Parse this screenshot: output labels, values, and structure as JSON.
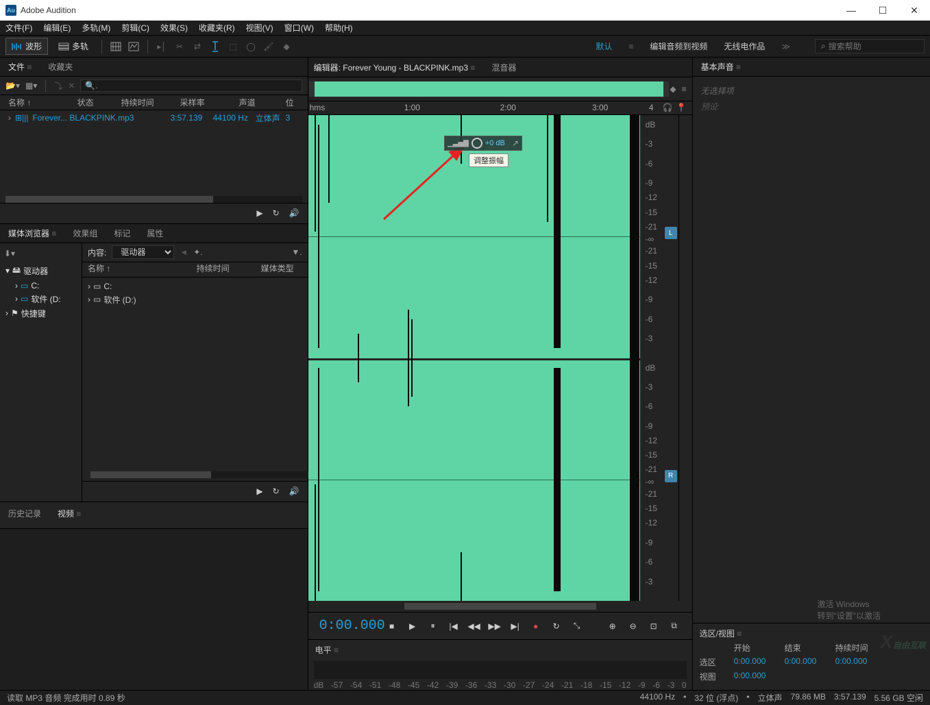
{
  "app": {
    "title": "Adobe Audition",
    "logo_text": "Au"
  },
  "menu": [
    "文件(F)",
    "编辑(E)",
    "多轨(M)",
    "剪辑(C)",
    "效果(S)",
    "收藏夹(R)",
    "视图(V)",
    "窗口(W)",
    "帮助(H)"
  ],
  "views": {
    "waveform": "波形",
    "multitrack": "多轨"
  },
  "workspaces": {
    "default": "默认",
    "edit_audio_to_video": "编辑音频到视频",
    "radio": "无线电作品"
  },
  "search_placeholder": "搜索帮助",
  "files_panel": {
    "tab_files": "文件",
    "tab_fav": "收藏夹",
    "headers": {
      "name": "名称 ↑",
      "status": "状态",
      "duration": "持续时间",
      "sample_rate": "采样率",
      "channels": "声道",
      "bit": "位"
    },
    "row": {
      "name": "Forever... BLACKPINK.mp3",
      "duration": "3:57.139",
      "sample_rate": "44100 Hz",
      "channels": "立体声",
      "bit": "3"
    }
  },
  "media_panel": {
    "tabs": [
      "媒体浏览器",
      "效果组",
      "标记",
      "属性"
    ],
    "content_label": "内容:",
    "content_value": "驱动器",
    "cols": {
      "name": "名称 ↑",
      "duration": "持续时间",
      "type": "媒体类型"
    },
    "tree": [
      "驱动器",
      "C:",
      "软件 (D:",
      "快捷键"
    ],
    "list": [
      "C:",
      "软件 (D:)"
    ]
  },
  "history": {
    "tab_history": "历史记录",
    "tab_video": "视频"
  },
  "editor": {
    "tab": "编辑器: Forever Young - BLACKPINK.mp3",
    "mixer": "混音器",
    "timeline": [
      "hms",
      "1:00",
      "2:00",
      "3:00",
      "4"
    ],
    "db_labels": [
      "dB",
      "-3",
      "-6",
      "-9",
      "-12",
      "-15",
      "-21",
      "-∞",
      "-21",
      "-15",
      "-12",
      "-9",
      "-6",
      "-3"
    ],
    "channel_L": "L",
    "channel_R": "R",
    "hud_value": "+0 dB",
    "tooltip": "调整振幅",
    "time": "0:00.000"
  },
  "levels": {
    "title": "电平",
    "marks": [
      "dB",
      "-57",
      "-54",
      "-51",
      "-48",
      "-45",
      "-42",
      "-39",
      "-36",
      "-33",
      "-30",
      "-27",
      "-24",
      "-21",
      "-18",
      "-15",
      "-12",
      "-9",
      "-6",
      "-3",
      "0"
    ]
  },
  "right_panel": {
    "title": "基本声音",
    "no_selection": "无选择项",
    "preset": "预设:"
  },
  "sel_view": {
    "title": "选区/视图",
    "cols": [
      "开始",
      "结束",
      "持续时间"
    ],
    "rows": {
      "sel": "选区",
      "view": "视图"
    },
    "values": {
      "sel_start": "0:00.000",
      "sel_end": "0:00.000",
      "sel_dur": "0:00.000",
      "view_start": "0:00.000"
    }
  },
  "status": {
    "left": "读取 MP3 音频 完成用时 0.89 秒",
    "sample": "44100 Hz",
    "bits": "32 位 (浮点)",
    "channels": "立体声",
    "mem": "79.86 MB",
    "dur": "3:57.139",
    "space": "5.56 GB 空闲"
  },
  "activate_hint": [
    "激活 Windows",
    "转到\"设置\"以激活"
  ]
}
